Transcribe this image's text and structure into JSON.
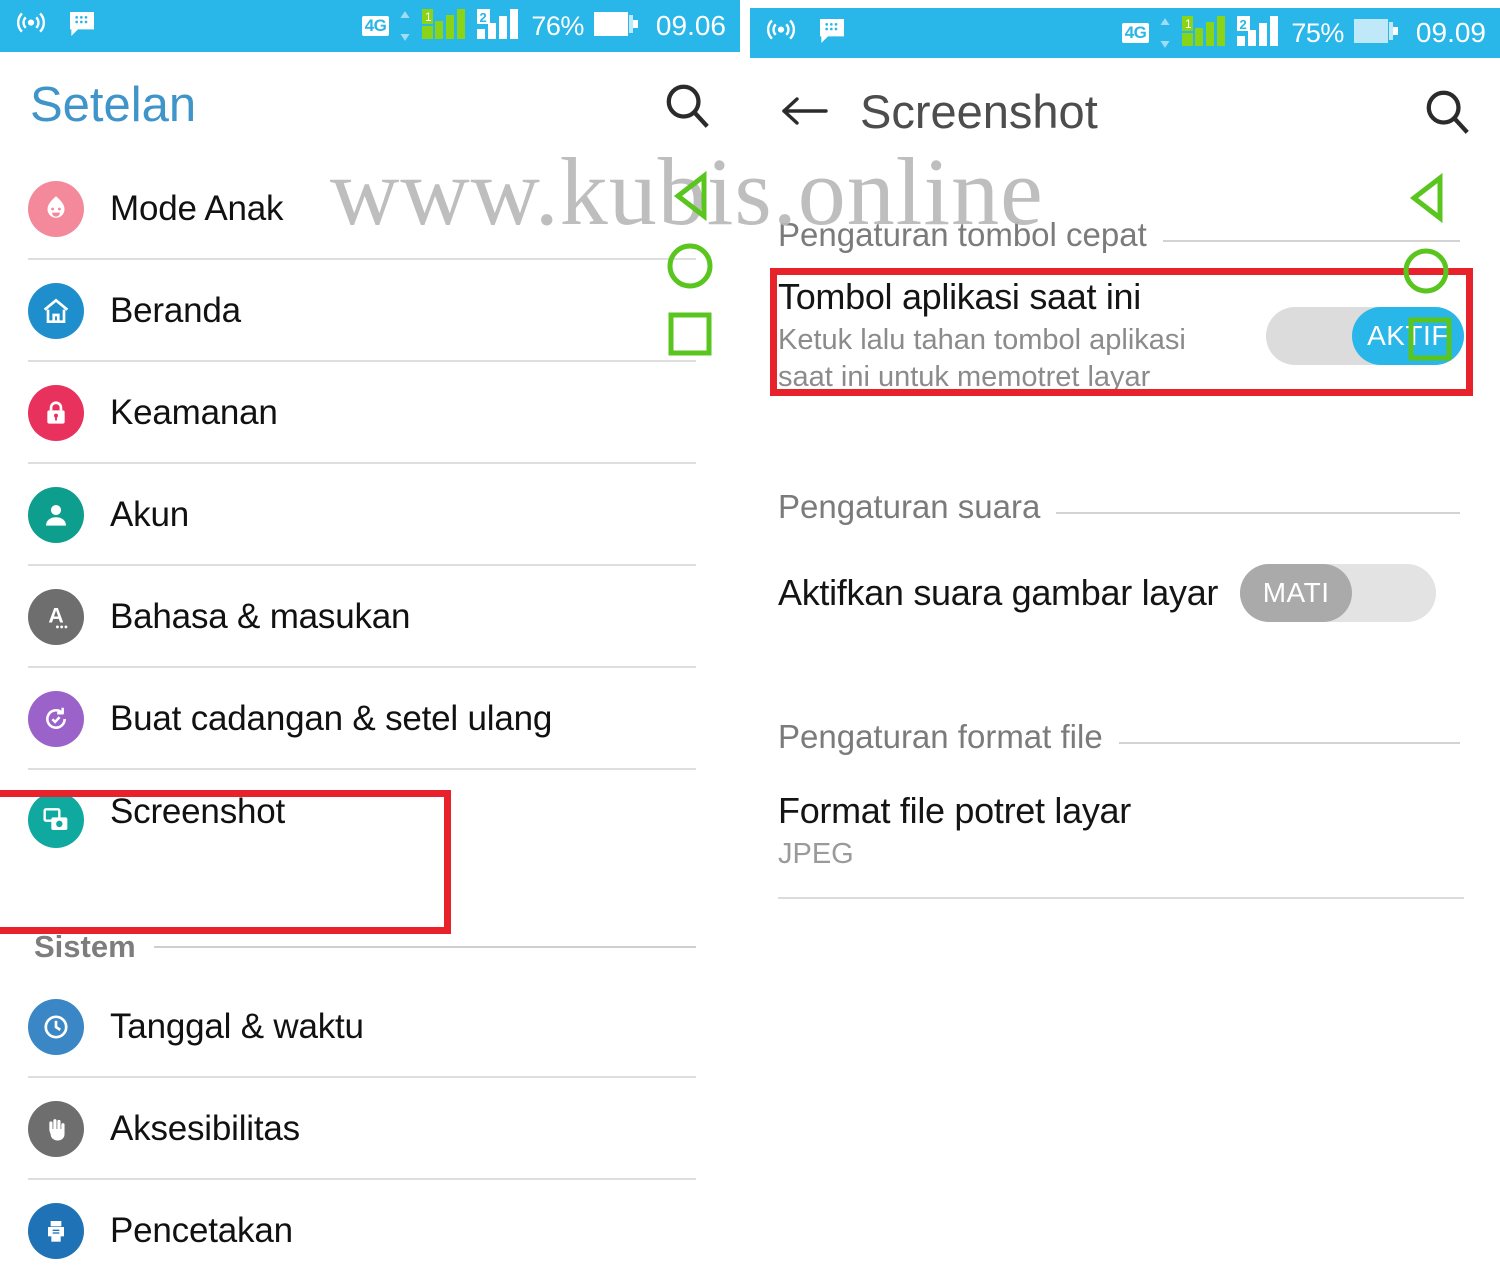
{
  "watermark": {
    "text": "www.kubis.online"
  },
  "left_panel": {
    "status_bar": {
      "hotspot_icon": "broadcast-icon",
      "message_icon": "chat-bubble-icon",
      "network_badge": "4G",
      "sim2_badge": "2",
      "battery_percent": "76%",
      "battery_icon": "battery-icon",
      "time": "09.06"
    },
    "appbar": {
      "title": "Setelan",
      "search_icon": "search-icon"
    },
    "items": [
      {
        "label": "Mode Anak",
        "icon": "child-face-icon",
        "color": "#f4899b"
      },
      {
        "label": "Beranda",
        "icon": "home-icon",
        "color": "#1e8fcc"
      },
      {
        "label": "Keamanan",
        "icon": "lock-icon",
        "color": "#e8315c"
      },
      {
        "label": "Akun",
        "icon": "person-icon",
        "color": "#0e9e8e"
      },
      {
        "label": "Bahasa & masukan",
        "icon": "letter-a-icon",
        "color": "#6e6e6e"
      },
      {
        "label": "Buat cadangan & setel ulang",
        "icon": "backup-reset-icon",
        "color": "#9b63c9"
      },
      {
        "label": "Screenshot",
        "icon": "screenshot-icon",
        "color": "#0fa9a0"
      }
    ],
    "section_system": {
      "label": "Sistem"
    },
    "system_items": [
      {
        "label": "Tanggal & waktu",
        "icon": "clock-icon",
        "color": "#3b86c4"
      },
      {
        "label": "Aksesibilitas",
        "icon": "hand-icon",
        "color": "#6e6e6e"
      },
      {
        "label": "Pencetakan",
        "icon": "printer-icon",
        "color": "#1f72b5"
      }
    ],
    "nav_overlay": {
      "back_icon": "triangle-back-icon",
      "home_icon": "circle-home-icon",
      "recents_icon": "square-recents-icon",
      "color": "#5bc520"
    },
    "highlight_color": "#e8222a"
  },
  "right_panel": {
    "status_bar": {
      "hotspot_icon": "broadcast-icon",
      "message_icon": "chat-bubble-icon",
      "network_badge": "4G",
      "sim2_badge": "2",
      "battery_percent": "75%",
      "battery_icon": "battery-icon",
      "time": "09.09"
    },
    "appbar": {
      "back_icon": "arrow-back-icon",
      "title": "Screenshot",
      "search_icon": "search-icon"
    },
    "groups": [
      {
        "heading": "Pengaturan tombol cepat",
        "items": [
          {
            "title": "Tombol aplikasi saat ini",
            "subtitle": "Ketuk lalu tahan tombol aplikasi saat ini untuk memotret layar",
            "toggle_state": "on",
            "toggle_label": "AKTIF"
          }
        ]
      },
      {
        "heading": "Pengaturan suara",
        "items": [
          {
            "title": "Aktifkan suara gambar layar",
            "subtitle": "",
            "toggle_state": "off",
            "toggle_label": "MATI"
          }
        ]
      },
      {
        "heading": "Pengaturan format file",
        "items": [
          {
            "title": "Format file potret layar",
            "value": "JPEG"
          }
        ]
      }
    ],
    "nav_overlay": {
      "back_icon": "triangle-back-icon",
      "home_icon": "circle-home-icon",
      "recents_icon": "square-recents-icon",
      "color": "#5bc520"
    },
    "highlight_color": "#e8222a"
  }
}
